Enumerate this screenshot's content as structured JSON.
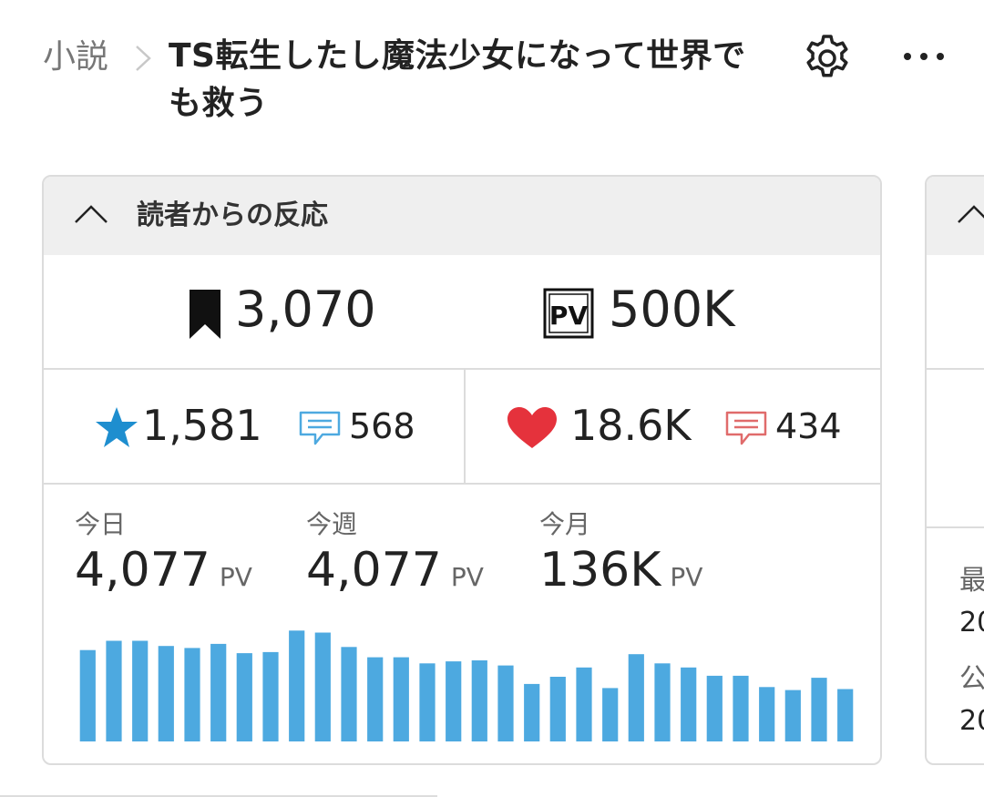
{
  "header": {
    "breadcrumb_parent": "小説",
    "title": "TS転生したし魔法少女になって世界でも救う"
  },
  "reactions_card": {
    "title": "読者からの反応",
    "bookmarks": "3,070",
    "total_pv": "500K",
    "stars": "1,581",
    "reviews": "568",
    "hearts": "18.6K",
    "comments": "434",
    "today_label": "今日",
    "today_value": "4,077",
    "week_label": "今週",
    "week_value": "4,077",
    "month_label": "今月",
    "month_value": "136K",
    "pv_unit": "PV"
  },
  "side_card": {
    "line1": "最",
    "line2": "20",
    "line3": "公",
    "line4": "20"
  },
  "colors": {
    "bar": "#4da9e0",
    "star": "#1e8ecf",
    "heart": "#e5323c",
    "review_icon": "#4da9e0",
    "comment_icon": "#e06b6b"
  },
  "icons": [
    "chevron-right-icon",
    "gear-icon",
    "more-icon",
    "chevron-up-icon",
    "bookmark-icon",
    "pv-icon",
    "star-icon",
    "comment-icon",
    "heart-icon"
  ],
  "chart_data": {
    "type": "bar",
    "values": [
      89,
      98,
      98,
      93,
      91,
      95,
      86,
      87,
      108,
      106,
      92,
      82,
      82,
      76,
      78,
      79,
      74,
      56,
      63,
      72,
      52,
      85,
      76,
      72,
      64,
      64,
      53,
      50,
      62,
      51
    ]
  }
}
